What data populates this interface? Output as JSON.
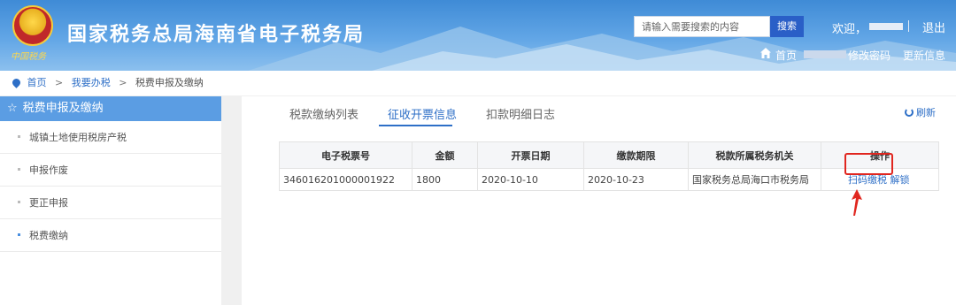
{
  "header": {
    "site_title": "国家税务总局海南省电子税务局",
    "emblem_caption": "中国税务",
    "search": {
      "placeholder": "请输入需要搜索的内容",
      "button_label": "搜索"
    },
    "welcome": "欢迎，",
    "logout": "退出",
    "home": "首页",
    "change_password": "修改密码",
    "update_info": "更新信息"
  },
  "breadcrumb": {
    "items": [
      "首页",
      "我要办税",
      "税费申报及缴纳"
    ],
    "separator": ">"
  },
  "sidebar": {
    "title": "税费申报及缴纳",
    "items": [
      {
        "label": "城镇土地使用税房产税"
      },
      {
        "label": "申报作废"
      },
      {
        "label": "更正申报"
      },
      {
        "label": "税费缴纳",
        "active": true
      }
    ]
  },
  "main": {
    "tabs": [
      {
        "label": "税款缴纳列表"
      },
      {
        "label": "征收开票信息",
        "active": true
      },
      {
        "label": "扣款明细日志"
      }
    ],
    "refresh_label": "刷新",
    "table": {
      "columns": [
        "电子税票号",
        "金额",
        "开票日期",
        "缴款期限",
        "税款所属税务机关",
        "操作"
      ],
      "rows": [
        {
          "ticket_no": "346016201000001922",
          "amount": "1800",
          "issue_date": "2020-10-10",
          "due_date": "2020-10-23",
          "tax_office": "国家税务总局海口市税务局",
          "actions": [
            "扫码缴税",
            "解锁"
          ]
        }
      ]
    }
  },
  "colors": {
    "header_blue": "#4a92dc",
    "link_blue": "#2e6fc7",
    "sidebar_head": "#5b9de3",
    "highlight_red": "#e0261f"
  }
}
